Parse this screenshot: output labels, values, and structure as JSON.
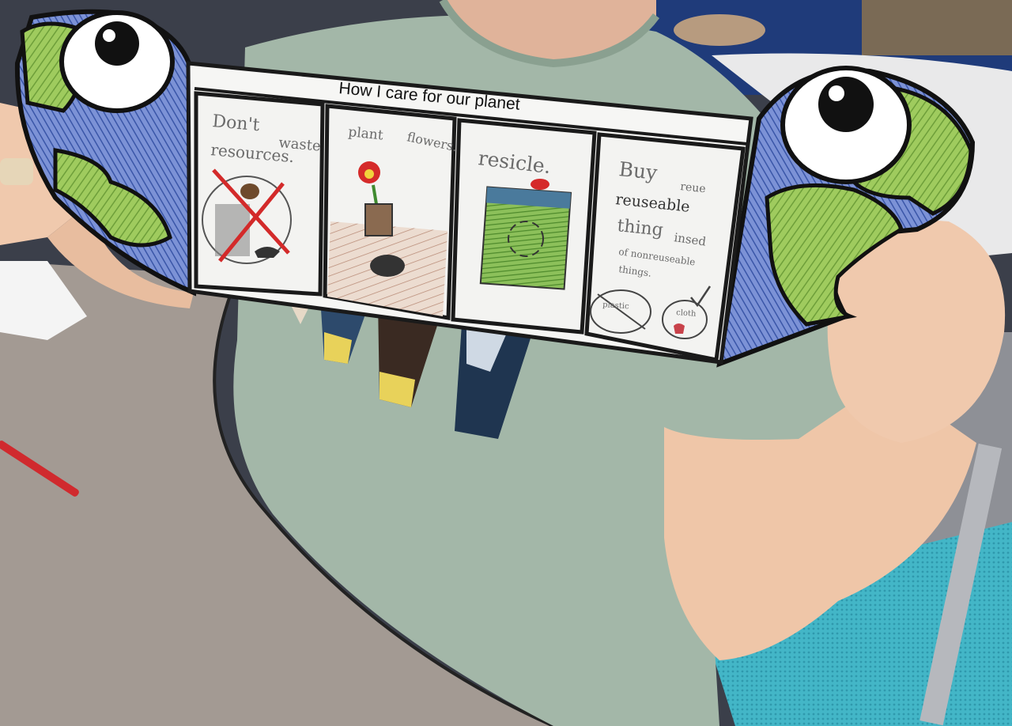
{
  "booklet": {
    "title": "How I care for our planet",
    "panels": [
      {
        "lines": [
          "Don't",
          "waste",
          "resources."
        ]
      },
      {
        "lines": [
          "plant",
          "flowers."
        ]
      },
      {
        "lines": [
          "resicle."
        ]
      },
      {
        "lines": [
          "Buy",
          "reue",
          "reuseable",
          "thing",
          "insed",
          "of nonreuseable",
          "things."
        ],
        "labels": [
          "plastic",
          "cloth"
        ]
      }
    ]
  },
  "colors": {
    "paper": "#f6f6f4",
    "frame": "#1a1a1a",
    "shirt": "#9fb3a4",
    "table": "#9a928b",
    "rug": "#3fb3c4",
    "crayon_green": "#7fb24a",
    "crayon_blue": "#3d5fb0",
    "skin": "#f0c9ad"
  }
}
